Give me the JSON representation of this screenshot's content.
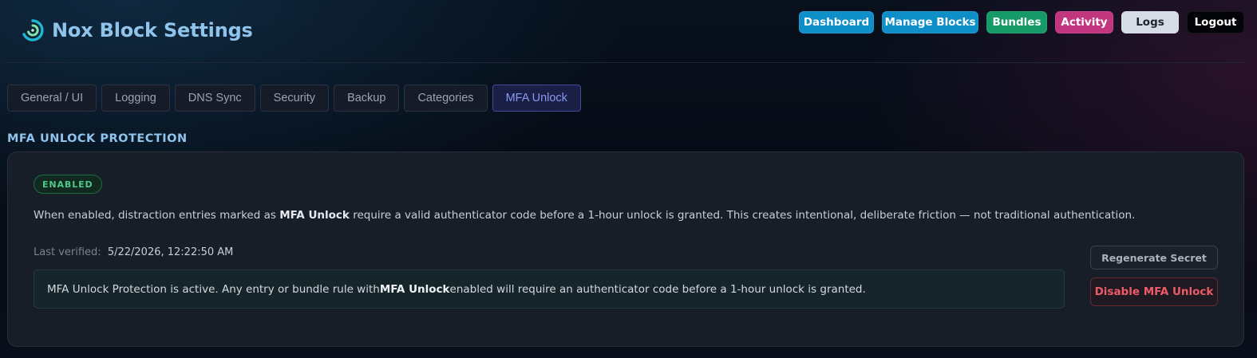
{
  "app": {
    "title": "Nox Block Settings",
    "logo_icon": "swirl-logo-icon",
    "accent_color": "#8fc4ec"
  },
  "nav": {
    "dashboard": "Dashboard",
    "manage_blocks": "Manage Blocks",
    "bundles": "Bundles",
    "activity": "Activity",
    "logs": "Logs",
    "logout": "Logout"
  },
  "tabs": [
    {
      "label": "General / UI",
      "active": false
    },
    {
      "label": "Logging",
      "active": false
    },
    {
      "label": "DNS Sync",
      "active": false
    },
    {
      "label": "Security",
      "active": false
    },
    {
      "label": "Backup",
      "active": false
    },
    {
      "label": "Categories",
      "active": false
    },
    {
      "label": "MFA Unlock",
      "active": true
    }
  ],
  "section": {
    "title": "MFA UNLOCK PROTECTION",
    "status_badge": "ENABLED",
    "status_color": "#4fc98a",
    "description_before": "When enabled, distraction entries marked as ",
    "description_bold": "MFA Unlock",
    "description_after": " require a valid authenticator code before a 1-hour unlock is granted. This creates intentional, deliberate friction — not traditional authentication.",
    "last_verified_label": "Last verified:",
    "last_verified_value": "5/22/2026, 12:22:50 AM",
    "info_before": "MFA Unlock Protection is active. Any entry or bundle rule with ",
    "info_bold": "MFA Unlock",
    "info_after": " enabled will require an authenticator code before a 1-hour unlock is granted.",
    "regenerate_label": "Regenerate Secret",
    "disable_label": "Disable MFA Unlock",
    "danger_color": "#ef5a6a"
  }
}
